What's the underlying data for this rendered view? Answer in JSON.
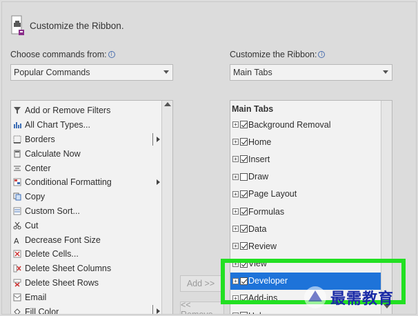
{
  "dialog": {
    "title": "Customize the Ribbon."
  },
  "commands_from": {
    "label": "Choose commands from:",
    "selected": "Popular Commands"
  },
  "customize_ribbon": {
    "label": "Customize the Ribbon:",
    "selected": "Main Tabs"
  },
  "commands": [
    {
      "label": "Add or Remove Filters",
      "icon": "filter-icon",
      "submenu": false,
      "split": false
    },
    {
      "label": "All Chart Types...",
      "icon": "chart-icon",
      "submenu": false,
      "split": false
    },
    {
      "label": "Borders",
      "icon": "borders-icon",
      "submenu": false,
      "split": true
    },
    {
      "label": "Calculate Now",
      "icon": "calculator-icon",
      "submenu": false,
      "split": false
    },
    {
      "label": "Center",
      "icon": "center-align-icon",
      "submenu": false,
      "split": false
    },
    {
      "label": "Conditional Formatting",
      "icon": "conditional-formatting-icon",
      "submenu": true,
      "split": false
    },
    {
      "label": "Copy",
      "icon": "copy-icon",
      "submenu": false,
      "split": false
    },
    {
      "label": "Custom Sort...",
      "icon": "sort-icon",
      "submenu": false,
      "split": false
    },
    {
      "label": "Cut",
      "icon": "scissors-icon",
      "submenu": false,
      "split": false
    },
    {
      "label": "Decrease Font Size",
      "icon": "decrease-font-icon",
      "submenu": false,
      "split": false
    },
    {
      "label": "Delete Cells...",
      "icon": "delete-cells-icon",
      "submenu": false,
      "split": false
    },
    {
      "label": "Delete Sheet Columns",
      "icon": "delete-columns-icon",
      "submenu": false,
      "split": false
    },
    {
      "label": "Delete Sheet Rows",
      "icon": "delete-rows-icon",
      "submenu": false,
      "split": false
    },
    {
      "label": "Email",
      "icon": "email-icon",
      "submenu": false,
      "split": false
    },
    {
      "label": "Fill Color",
      "icon": "fill-color-icon",
      "submenu": false,
      "split": true
    }
  ],
  "tabs_tree": {
    "header": "Main Tabs",
    "items": [
      {
        "label": "Background Removal",
        "checked": true,
        "selected": false
      },
      {
        "label": "Home",
        "checked": true,
        "selected": false
      },
      {
        "label": "Insert",
        "checked": true,
        "selected": false
      },
      {
        "label": "Draw",
        "checked": false,
        "selected": false
      },
      {
        "label": "Page Layout",
        "checked": true,
        "selected": false
      },
      {
        "label": "Formulas",
        "checked": true,
        "selected": false
      },
      {
        "label": "Data",
        "checked": true,
        "selected": false
      },
      {
        "label": "Review",
        "checked": true,
        "selected": false
      },
      {
        "label": "View",
        "checked": true,
        "selected": false
      },
      {
        "label": "Developer",
        "checked": true,
        "selected": true
      },
      {
        "label": "Add-ins",
        "checked": true,
        "selected": false
      },
      {
        "label": "Help",
        "checked": true,
        "selected": false
      }
    ]
  },
  "buttons": {
    "add": "Add >>",
    "remove": "<< Remove"
  },
  "watermark": {
    "text": "最需教育"
  },
  "colors": {
    "selection": "#1e73d9",
    "highlight": "#22e022",
    "watermark": "#1a2aa6"
  }
}
